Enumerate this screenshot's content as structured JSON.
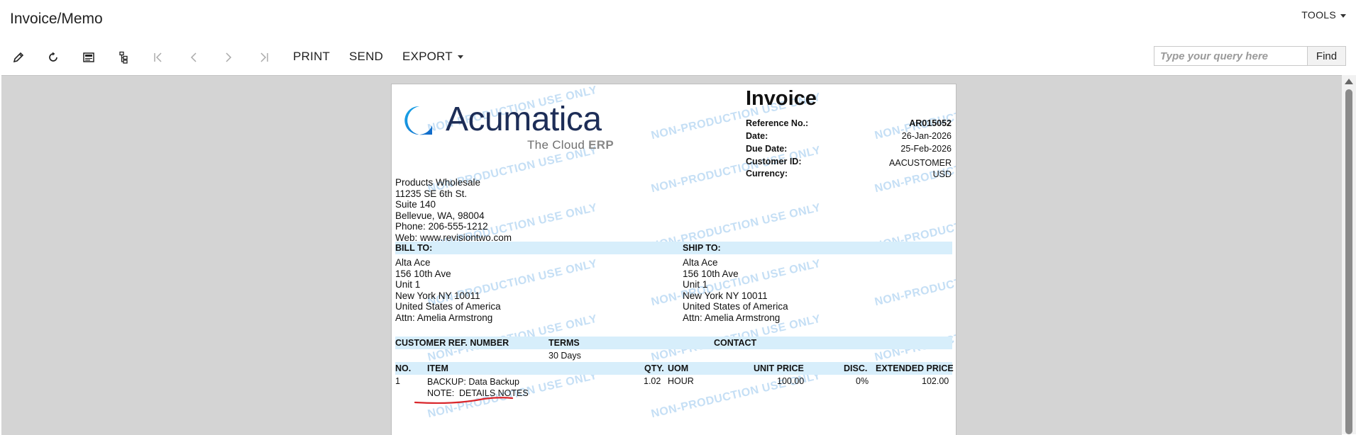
{
  "header": {
    "title": "Invoice/Memo",
    "tools_label": "TOOLS"
  },
  "toolbar": {
    "icons": [
      "pencil-icon",
      "refresh-icon",
      "screen-icon",
      "tree-icon",
      "first-icon",
      "prev-icon",
      "next-icon",
      "last-icon"
    ],
    "print": "PRINT",
    "send": "SEND",
    "export": "EXPORT",
    "search_placeholder": "Type your query here",
    "find": "Find"
  },
  "report": {
    "watermark": "NON-PRODUCTION USE ONLY",
    "logo": {
      "word": "Acumatica",
      "tagline_light": "The Cloud ",
      "tagline_bold": "ERP"
    },
    "title": "Invoice",
    "meta": [
      {
        "label": "Reference No.:",
        "value": "AR015052"
      },
      {
        "label": "Date:",
        "value": "26-Jan-2026"
      },
      {
        "label": "Due Date:",
        "value": "25-Feb-2026"
      },
      {
        "label": "Customer ID:",
        "value": "AACUSTOMER"
      },
      {
        "label": "Currency:",
        "value": "USD"
      }
    ],
    "company": [
      "Products Wholesale",
      "11235 SE 6th St.",
      "Suite 140",
      "Bellevue, WA, 98004",
      "Phone: 206-555-1212",
      "Web: www.revisiontwo.com"
    ],
    "bill_to_label": "BILL TO:",
    "ship_to_label": "SHIP TO:",
    "bill_to": [
      "Alta Ace",
      "156 10th Ave",
      "Unit 1",
      "New York NY 10011",
      "United States of America",
      "Attn: Amelia Armstrong"
    ],
    "ship_to": [
      "Alta Ace",
      "156 10th Ave",
      "Unit 1",
      "New York NY 10011",
      "United States of America",
      "Attn: Amelia Armstrong"
    ],
    "terms_headers": {
      "ref": "CUSTOMER REF. NUMBER",
      "terms": "TERMS",
      "contact": "CONTACT"
    },
    "terms_value": "30 Days",
    "line_headers": {
      "no": "NO.",
      "item": "ITEM",
      "qty": "QTY.",
      "uom": "UOM",
      "unit_price": "UNIT PRICE",
      "disc": "DISC.",
      "ext_price": "EXTENDED PRICE"
    },
    "lines": [
      {
        "no": "1",
        "item": "BACKUP: Data Backup",
        "qty": "1.02",
        "uom": "HOUR",
        "unit_price": "100.00",
        "disc": "0%",
        "ext_price": "102.00"
      }
    ],
    "note_label": "NOTE:",
    "note_text": "DETAILS NOTES",
    "annotation_color": "#d9262b"
  }
}
